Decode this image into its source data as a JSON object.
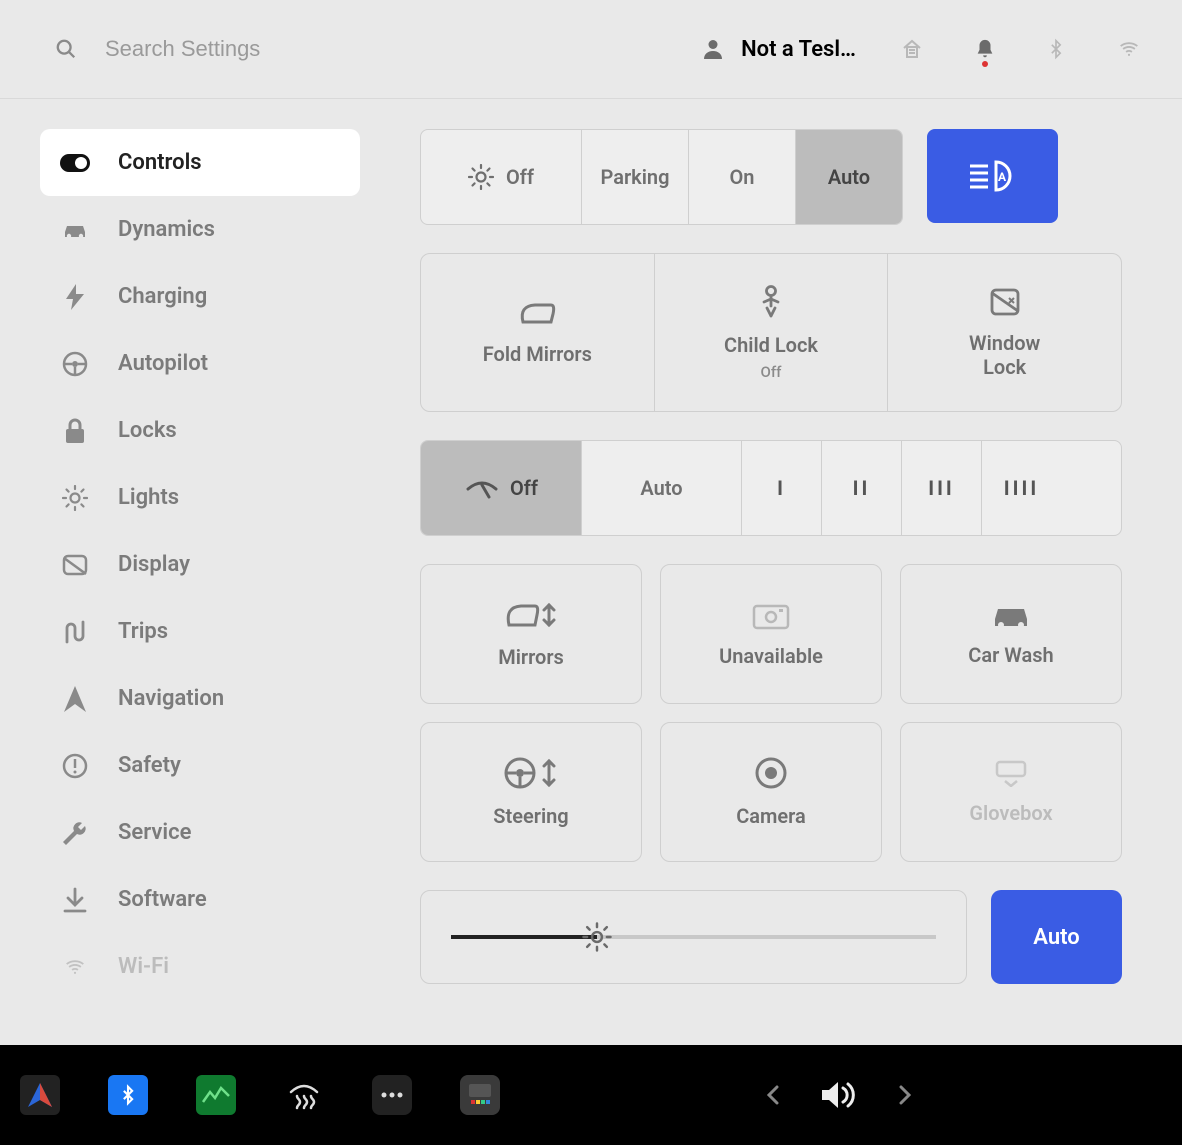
{
  "search": {
    "placeholder": "Search Settings"
  },
  "profile": {
    "name": "Not a Tesl…"
  },
  "sidebar": {
    "items": [
      {
        "label": "Controls",
        "icon": "toggle",
        "active": true
      },
      {
        "label": "Dynamics",
        "icon": "car"
      },
      {
        "label": "Charging",
        "icon": "bolt"
      },
      {
        "label": "Autopilot",
        "icon": "wheel"
      },
      {
        "label": "Locks",
        "icon": "lock"
      },
      {
        "label": "Lights",
        "icon": "sun"
      },
      {
        "label": "Display",
        "icon": "display"
      },
      {
        "label": "Trips",
        "icon": "route"
      },
      {
        "label": "Navigation",
        "icon": "arrow"
      },
      {
        "label": "Safety",
        "icon": "alert"
      },
      {
        "label": "Service",
        "icon": "wrench"
      },
      {
        "label": "Software",
        "icon": "download"
      },
      {
        "label": "Wi-Fi",
        "icon": "wifi",
        "faded": true
      }
    ]
  },
  "lights": {
    "options": [
      "Off",
      "Parking",
      "On",
      "Auto"
    ],
    "selected": "Auto",
    "auto_high_beam_on": true
  },
  "quick_tiles": [
    {
      "label": "Fold Mirrors"
    },
    {
      "label": "Child Lock",
      "sub": "Off"
    },
    {
      "label": "Window\nLock"
    }
  ],
  "wipers": {
    "options_labeled": [
      "Off",
      "Auto"
    ],
    "speed_marks": [
      "I",
      "II",
      "III",
      "IIII"
    ],
    "selected": "Off"
  },
  "control_grid": [
    {
      "label": "Mirrors"
    },
    {
      "label": "Unavailable"
    },
    {
      "label": "Car Wash"
    },
    {
      "label": "Steering"
    },
    {
      "label": "Camera"
    },
    {
      "label": "Glovebox",
      "disabled": true
    }
  ],
  "brightness": {
    "value_pct": 30,
    "auto_label": "Auto",
    "auto_on": true
  }
}
